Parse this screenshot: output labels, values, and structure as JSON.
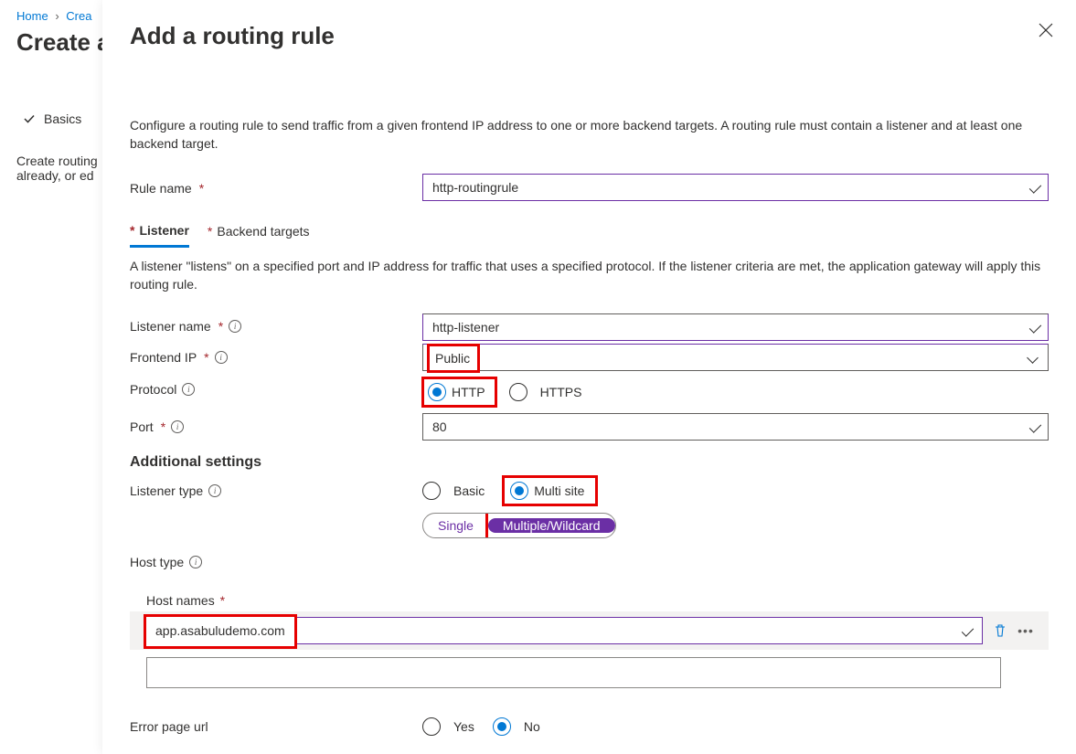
{
  "breadcrumb": {
    "home": "Home",
    "create": "Crea"
  },
  "page_title": "Create a",
  "bg_step": "Basics",
  "bg_desc": "Create routing already, or ed",
  "panel_title": "Add a routing rule",
  "panel_desc": "Configure a routing rule to send traffic from a given frontend IP address to one or more backend targets. A routing rule must contain a listener and at least one backend target.",
  "rule_name": {
    "label": "Rule name",
    "value": "http-routingrule"
  },
  "tabs": {
    "listener": "Listener",
    "backend": "Backend targets"
  },
  "listener_desc": "A listener \"listens\" on a specified port and IP address for traffic that uses a specified protocol. If the listener criteria are met, the application gateway will apply this routing rule.",
  "listener_name": {
    "label": "Listener name",
    "value": "http-listener"
  },
  "frontend_ip": {
    "label": "Frontend IP",
    "value": "Public"
  },
  "protocol": {
    "label": "Protocol",
    "http": "HTTP",
    "https": "HTTPS"
  },
  "port": {
    "label": "Port",
    "value": "80"
  },
  "additional": "Additional settings",
  "listener_type": {
    "label": "Listener type",
    "basic": "Basic",
    "multi": "Multi site"
  },
  "host_type": {
    "label": "Host type",
    "single": "Single",
    "multiple": "Multiple/Wildcard"
  },
  "host_names": {
    "label": "Host names",
    "value": "app.asabuludemo.com"
  },
  "error_page": {
    "label": "Error page url",
    "yes": "Yes",
    "no": "No"
  }
}
